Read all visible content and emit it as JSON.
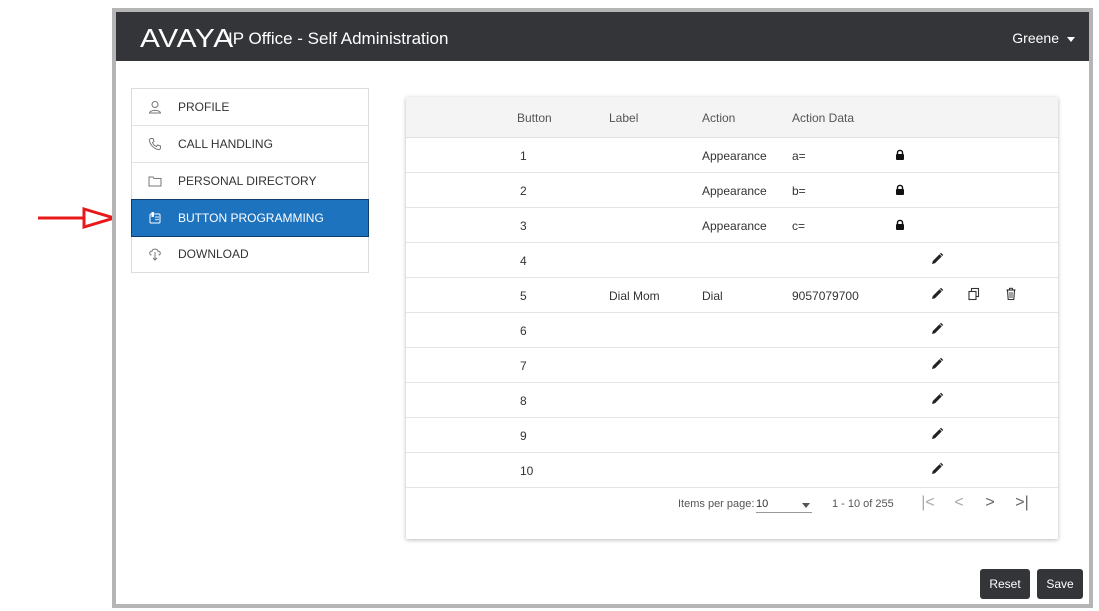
{
  "header": {
    "logo": "AVAYA",
    "app_title": "IP Office - Self Administration",
    "user": "Greene"
  },
  "sidebar": {
    "items": [
      {
        "label": "PROFILE",
        "icon": "person-icon",
        "active": false
      },
      {
        "label": "CALL HANDLING",
        "icon": "phone-icon",
        "active": false
      },
      {
        "label": "PERSONAL DIRECTORY",
        "icon": "folder-icon",
        "active": false
      },
      {
        "label": "BUTTON PROGRAMMING",
        "icon": "phone-buttons-icon",
        "active": true
      },
      {
        "label": "DOWNLOAD",
        "icon": "download-icon",
        "active": false
      }
    ]
  },
  "annotation": {
    "color": "#e8191b"
  },
  "table": {
    "headers": {
      "button": "Button",
      "label": "Label",
      "action": "Action",
      "action_data": "Action Data"
    },
    "rows": [
      {
        "button": "1",
        "label": "",
        "action": "Appearance",
        "action_data": "a=",
        "locked": true
      },
      {
        "button": "2",
        "label": "",
        "action": "Appearance",
        "action_data": "b=",
        "locked": true
      },
      {
        "button": "3",
        "label": "",
        "action": "Appearance",
        "action_data": "c=",
        "locked": true
      },
      {
        "button": "4",
        "label": "",
        "action": "",
        "action_data": "",
        "locked": false
      },
      {
        "button": "5",
        "label": "Dial Mom",
        "action": "Dial",
        "action_data": "9057079700",
        "locked": false,
        "extra_actions": true
      },
      {
        "button": "6",
        "label": "",
        "action": "",
        "action_data": "",
        "locked": false
      },
      {
        "button": "7",
        "label": "",
        "action": "",
        "action_data": "",
        "locked": false
      },
      {
        "button": "8",
        "label": "",
        "action": "",
        "action_data": "",
        "locked": false
      },
      {
        "button": "9",
        "label": "",
        "action": "",
        "action_data": "",
        "locked": false
      },
      {
        "button": "10",
        "label": "",
        "action": "",
        "action_data": "",
        "locked": false
      }
    ]
  },
  "paginator": {
    "items_per_page_label": "Items per page:",
    "items_per_page": "10",
    "range": "1 - 10 of 255",
    "first": "|<",
    "prev": "<",
    "next": ">",
    "last": ">|"
  },
  "footer": {
    "reset": "Reset",
    "save": "Save"
  },
  "colors": {
    "header_bg": "#333539",
    "active_nav": "#1e73be",
    "button_bg": "#333539"
  }
}
